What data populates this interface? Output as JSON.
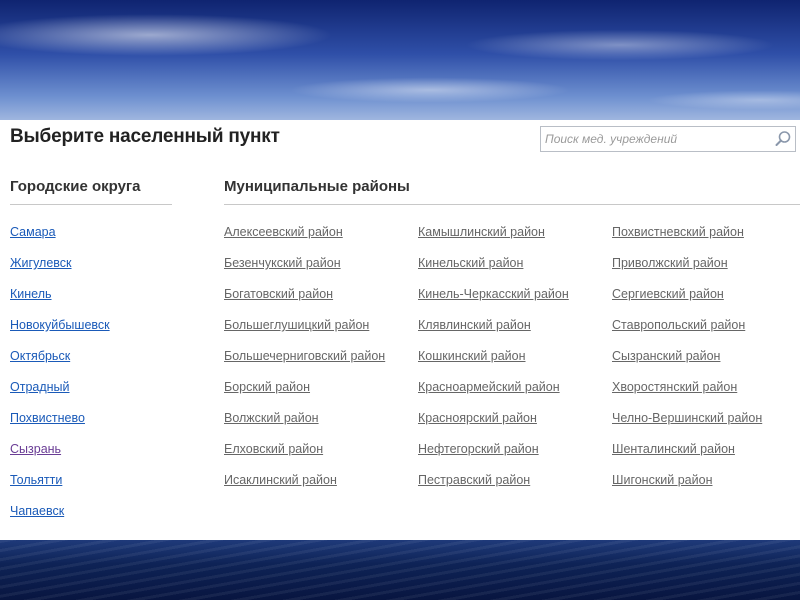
{
  "page": {
    "title": "Выберите населенный пункт"
  },
  "search": {
    "placeholder": "Поиск мед. учреждений"
  },
  "city_districts": {
    "heading": "Городские округа",
    "items": [
      "Самара",
      "Жигулевск",
      "Кинель",
      "Новокуйбышевск",
      "Октябрьск",
      "Отрадный",
      "Похвистнево",
      "Сызрань",
      "Тольятти",
      "Чапаевск"
    ],
    "visited": [
      false,
      false,
      false,
      false,
      false,
      false,
      false,
      true,
      false,
      false
    ]
  },
  "municipal_districts": {
    "heading": "Муниципальные районы",
    "columns": [
      [
        "Алексеевский район",
        "Безенчукский район",
        "Богатовский район",
        "Большеглушицкий район",
        "Большечерниговский район",
        "Борский район",
        "Волжский район",
        "Елховский район",
        "Исаклинский район"
      ],
      [
        "Камышлинский район",
        "Кинельский район",
        "Кинель-Черкасский район",
        "Клявлинский район",
        "Кошкинский район",
        "Красноармейский район",
        "Красноярский район",
        "Нефтегорский район",
        "Пестравский район"
      ],
      [
        "Похвистневский район",
        "Приволжский район",
        "Сергиевский район",
        "Ставропольский район",
        "Сызранский район",
        "Хворостянский район",
        "Челно-Вершинский район",
        "Шенталинский район",
        "Шигонский район"
      ]
    ]
  },
  "colors": {
    "link": "#1a5ab8",
    "link_visited": "#6a3d95",
    "link_muted": "#666666",
    "heading": "#333333"
  }
}
